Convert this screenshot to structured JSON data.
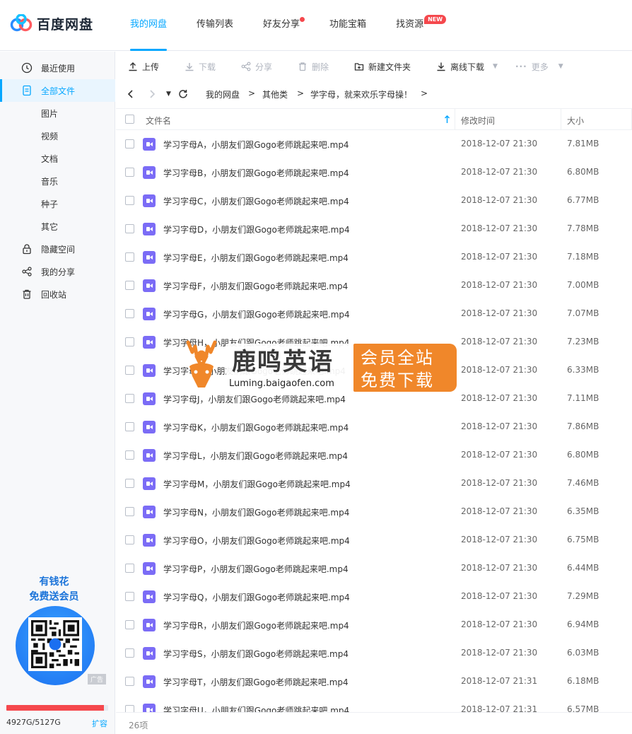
{
  "app": {
    "name": "百度网盘"
  },
  "topnav": {
    "items": [
      {
        "label": "我的网盘",
        "active": true
      },
      {
        "label": "传输列表"
      },
      {
        "label": "好友分享",
        "dot": true
      },
      {
        "label": "功能宝箱"
      },
      {
        "label": "找资源",
        "badge": "NEW"
      }
    ]
  },
  "sidebar": {
    "items": [
      {
        "label": "最近使用",
        "icon": "clock-icon"
      },
      {
        "label": "全部文件",
        "icon": "file-icon",
        "active": true
      },
      {
        "label": "图片"
      },
      {
        "label": "视频"
      },
      {
        "label": "文档"
      },
      {
        "label": "音乐"
      },
      {
        "label": "种子"
      },
      {
        "label": "其它"
      },
      {
        "label": "隐藏空间",
        "icon": "lock-icon"
      },
      {
        "label": "我的分享",
        "icon": "share-icon"
      },
      {
        "label": "回收站",
        "icon": "trash-icon"
      }
    ],
    "promo": {
      "line1": "有钱花",
      "line2": "免费送会员",
      "ad_tag": "广告"
    },
    "quota": {
      "text": "4927G/5127G",
      "used_fraction": 0.961,
      "expand": "扩容"
    }
  },
  "toolbar": {
    "upload": "上传",
    "download": "下载",
    "share": "分享",
    "delete": "删除",
    "new_folder": "新建文件夹",
    "offline_download": "离线下载",
    "more": "更多"
  },
  "breadcrumb": [
    "我的网盘",
    "其他类",
    "学字母，就来欢乐字母操！"
  ],
  "table": {
    "col_name": "文件名",
    "col_time": "修改时间",
    "col_size": "大小",
    "rows": [
      {
        "name": "学习字母A，小朋友们跟Gogo老师跳起来吧.mp4",
        "time": "2018-12-07 21:30",
        "size": "7.81MB"
      },
      {
        "name": "学习字母B，小朋友们跟Gogo老师跳起来吧.mp4",
        "time": "2018-12-07 21:30",
        "size": "6.80MB"
      },
      {
        "name": "学习字母C，小朋友们跟Gogo老师跳起来吧.mp4",
        "time": "2018-12-07 21:30",
        "size": "6.77MB"
      },
      {
        "name": "学习字母D，小朋友们跟Gogo老师跳起来吧.mp4",
        "time": "2018-12-07 21:30",
        "size": "7.78MB"
      },
      {
        "name": "学习字母E，小朋友们跟Gogo老师跳起来吧.mp4",
        "time": "2018-12-07 21:30",
        "size": "7.18MB"
      },
      {
        "name": "学习字母F，小朋友们跟Gogo老师跳起来吧.mp4",
        "time": "2018-12-07 21:30",
        "size": "7.00MB"
      },
      {
        "name": "学习字母G，小朋友们跟Gogo老师跳起来吧.mp4",
        "time": "2018-12-07 21:30",
        "size": "7.07MB"
      },
      {
        "name": "学习字母H，小朋友们跟Gogo老师跳起来吧.mp4",
        "time": "2018-12-07 21:30",
        "size": "7.23MB"
      },
      {
        "name": "学习字母I，小朋友们跟Gogo老师跳起来吧.mp4",
        "time": "2018-12-07 21:30",
        "size": "6.33MB"
      },
      {
        "name": "学习字母J，小朋友们跟Gogo老师跳起来吧.mp4",
        "time": "2018-12-07 21:30",
        "size": "7.11MB"
      },
      {
        "name": "学习字母K，小朋友们跟Gogo老师跳起来吧.mp4",
        "time": "2018-12-07 21:30",
        "size": "7.86MB"
      },
      {
        "name": "学习字母L，小朋友们跟Gogo老师跳起来吧.mp4",
        "time": "2018-12-07 21:30",
        "size": "6.80MB"
      },
      {
        "name": "学习字母M，小朋友们跟Gogo老师跳起来吧.mp4",
        "time": "2018-12-07 21:30",
        "size": "7.46MB"
      },
      {
        "name": "学习字母N，小朋友们跟Gogo老师跳起来吧.mp4",
        "time": "2018-12-07 21:30",
        "size": "6.35MB"
      },
      {
        "name": "学习字母O，小朋友们跟Gogo老师跳起来吧.mp4",
        "time": "2018-12-07 21:30",
        "size": "6.75MB"
      },
      {
        "name": "学习字母P，小朋友们跟Gogo老师跳起来吧.mp4",
        "time": "2018-12-07 21:30",
        "size": "6.44MB"
      },
      {
        "name": "学习字母Q，小朋友们跟Gogo老师跳起来吧.mp4",
        "time": "2018-12-07 21:30",
        "size": "7.29MB"
      },
      {
        "name": "学习字母R，小朋友们跟Gogo老师跳起来吧.mp4",
        "time": "2018-12-07 21:30",
        "size": "6.94MB"
      },
      {
        "name": "学习字母S，小朋友们跟Gogo老师跳起来吧.mp4",
        "time": "2018-12-07 21:30",
        "size": "6.03MB"
      },
      {
        "name": "学习字母T，小朋友们跟Gogo老师跳起来吧.mp4",
        "time": "2018-12-07 21:31",
        "size": "6.18MB"
      },
      {
        "name": "学习字母U，小朋友们跟Gogo老师跳起来吧.mp4",
        "time": "2018-12-07 21:31",
        "size": "6.57MB"
      }
    ],
    "count": "26项"
  },
  "watermark": {
    "title": "鹿鸣英语",
    "url": "Luming.baigaofen.com",
    "badge_line1": "会员全站",
    "badge_line2": "免费下载"
  },
  "colors": {
    "accent": "#06a7ff",
    "video_icon": "#7b6cf6",
    "quota": "#f5484d",
    "watermark": "#f0872a"
  }
}
